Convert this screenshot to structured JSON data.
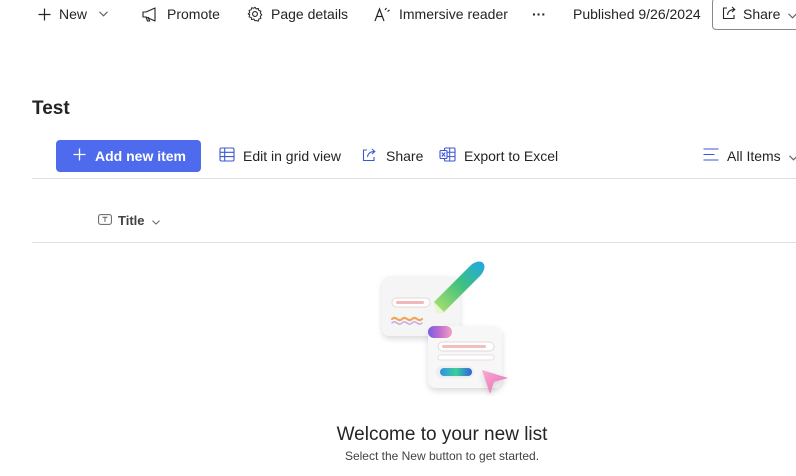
{
  "command_bar": {
    "new_label": "New",
    "promote_label": "Promote",
    "page_details_label": "Page details",
    "immersive_reader_label": "Immersive reader",
    "more_label": "···",
    "published_label": "Published 9/26/2024",
    "share_label": "Share",
    "icons": [
      "plus-icon",
      "chevron-down-icon",
      "megaphone-icon",
      "gear-icon",
      "immersive-reader-icon",
      "more-icon",
      "share-icon"
    ]
  },
  "list": {
    "title": "Test",
    "toolbar": {
      "add_item_label": "Add new item",
      "edit_grid_label": "Edit in grid view",
      "share_label": "Share",
      "export_label": "Export to Excel",
      "view_label": "All Items"
    },
    "columns": [
      {
        "label": "Title",
        "icon": "text-field-icon"
      }
    ]
  },
  "empty_state": {
    "title": "Welcome to your new list",
    "subtitle": "Select the New button to get started."
  },
  "colors": {
    "accent": "#4f6bed",
    "text": "#242424",
    "divider": "#e1dfdd"
  }
}
